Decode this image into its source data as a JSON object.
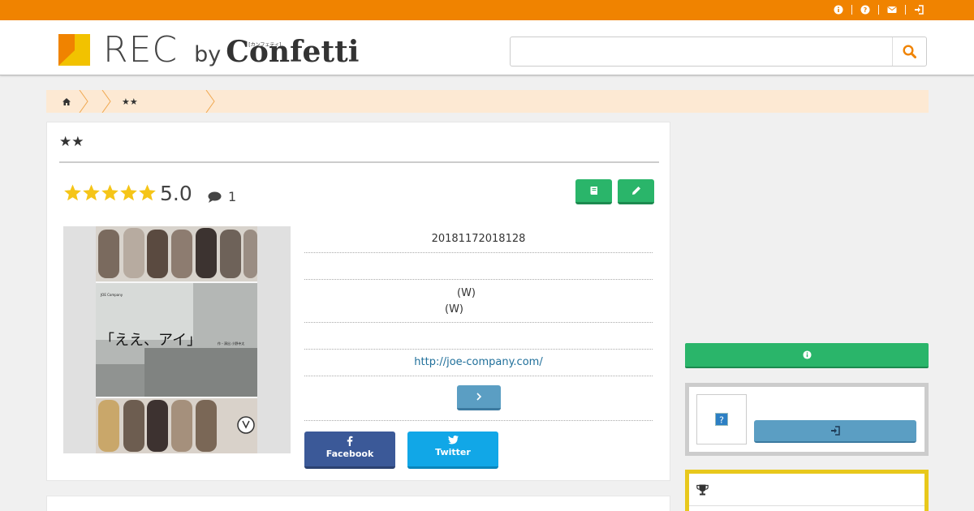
{
  "topbar": {
    "icons": [
      "info-icon",
      "question-icon",
      "mail-icon",
      "login-icon"
    ],
    "color": "#f08300"
  },
  "header": {
    "logo_rec": "REC",
    "logo_by": "by",
    "logo_confetti": "Confetti",
    "logo_kana": "[カンフェティ]",
    "search_placeholder": "",
    "search_icon": "search-icon"
  },
  "breadcrumb": {
    "home_icon": "home-icon",
    "items": [
      "",
      "",
      "★★"
    ]
  },
  "main": {
    "title": "★★",
    "rating": "5.0",
    "stars": 5,
    "comment_count": "1",
    "buttons": [
      "book-icon",
      "pencil-icon"
    ],
    "info": {
      "date": "20181172018128",
      "cast_1": "(W)",
      "cast_2": "(W)",
      "url": "http://joe-company.com/",
      "more_icon": "chevron-right-icon"
    },
    "poster": {
      "company": "JOE Company",
      "stage_title": "「ええ、アイ」",
      "credit": "作・演出 小野寺太"
    },
    "share": {
      "facebook": "Facebook",
      "twitter": "Twitter"
    }
  },
  "sidebar": {
    "info_icon": "info-icon",
    "login_icon": "login-icon",
    "avatar_icon": "question-icon",
    "ranking_icon": "trophy-icon"
  },
  "colors": {
    "accent": "#f08300",
    "green": "#2ab56a",
    "blue": "#5b9ec3",
    "facebook": "#3b5998",
    "twitter": "#11a7e7",
    "star": "#f5c518",
    "ranking_border": "#e8c81c"
  }
}
